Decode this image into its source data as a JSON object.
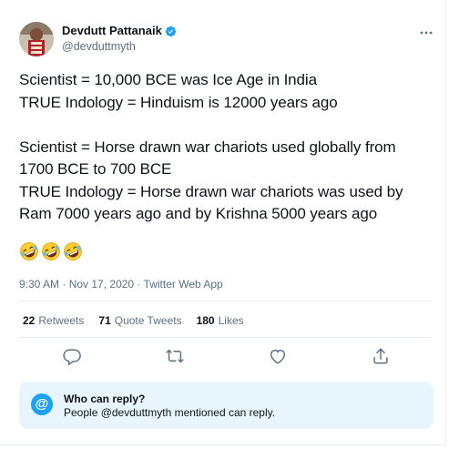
{
  "author": {
    "display_name": "Devdutt Pattanaik",
    "handle": "@devduttmyth",
    "verified": true,
    "avatar_icon": "profile-photo-avatar"
  },
  "tweet": {
    "lines": [
      "Scientist = 10,000 BCE was Ice Age in India",
      "TRUE Indology = Hinduism is 12000 years ago",
      "",
      "Scientist = Horse drawn war chariots used globally from",
      "1700 BCE to 700 BCE",
      "TRUE Indology = Horse drawn war chariots was used by",
      "Ram 7000 years ago and by Krishna 5000 years ago"
    ],
    "emoji": [
      "🤣",
      "🤣",
      "🤣"
    ]
  },
  "meta": {
    "time": "9:30 AM",
    "separator1": " · ",
    "date": "Nov 17, 2020",
    "separator2": " · ",
    "source": "Twitter Web App"
  },
  "stats": {
    "retweets_count": "22",
    "retweets_label": "Retweets",
    "quotes_count": "71",
    "quotes_label": "Quote Tweets",
    "likes_count": "180",
    "likes_label": "Likes"
  },
  "actions": {
    "reply_icon": "reply-icon",
    "retweet_icon": "retweet-icon",
    "like_icon": "like-icon",
    "share_icon": "share-icon"
  },
  "reply_settings": {
    "badge": "@",
    "title": "Who can reply?",
    "description": "People @devduttmyth mentioned can reply."
  },
  "colors": {
    "accent": "#1da1f2",
    "text_primary": "#0f1419",
    "text_secondary": "#5b7083",
    "reply_box_bg": "#e8f5fd",
    "divider": "#e6ecf0",
    "icon_gray": "#5b7083"
  }
}
